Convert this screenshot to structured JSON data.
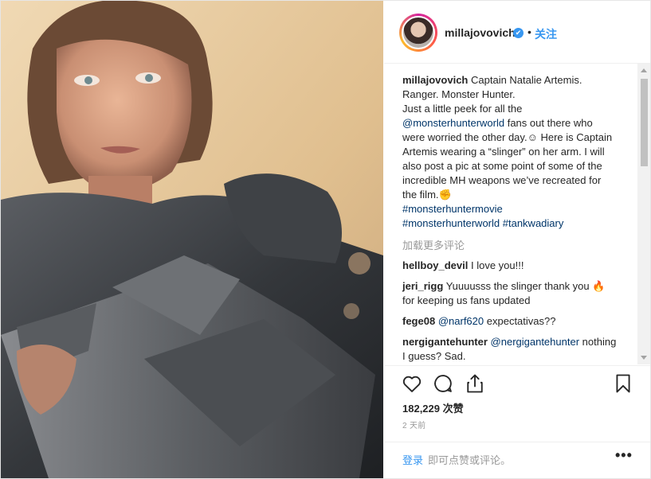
{
  "post": {
    "username": "millajovovich",
    "follow_label": "关注",
    "separator": "•",
    "verified_icon": "✔",
    "caption": {
      "author": "millajovovich",
      "line1": "Captain Natalie Artemis. Ranger. Monster Hunter.",
      "line2": "Just a little peek for all the",
      "mention": "@monsterhunterworld",
      "line3": "fans out there who were worried the other day.",
      "emoji1": "☺",
      "line4": "Here is Captain Artemis wearing a “slinger” on her arm. I will also post a pic at some point of some of the incredible MH weapons we’ve recreated for the film.",
      "emoji2": "✊",
      "hashtag1": "#monsterhuntermovie",
      "hashtag2": "#monsterhunterworld",
      "hashtag3": "#tankwadiary"
    },
    "load_more": "加载更多评论",
    "comments": [
      {
        "user": "hellboy_devil",
        "text": "I love you!!!"
      },
      {
        "user": "jeri_rigg",
        "text": "Yuuuusss the slinger thank you 🔥 for keeping us fans updated"
      },
      {
        "user": "fege08",
        "mention": "@narf620",
        "text": "expectativas??"
      },
      {
        "user": "nergigantehunter",
        "mention": "@nergigantehunter",
        "text": "nothing I guess? Sad."
      }
    ],
    "likes": "182,229 次赞",
    "time": "2 天前",
    "login_label": "登录",
    "login_hint": "即可点赞或评论。",
    "more_options": "•••"
  },
  "icons": [
    "heart-icon",
    "comment-icon",
    "share-icon",
    "bookmark-icon",
    "verified-badge-icon"
  ],
  "colors": {
    "link": "#003569",
    "accent": "#3897f0",
    "muted": "#999999",
    "text": "#262626"
  }
}
